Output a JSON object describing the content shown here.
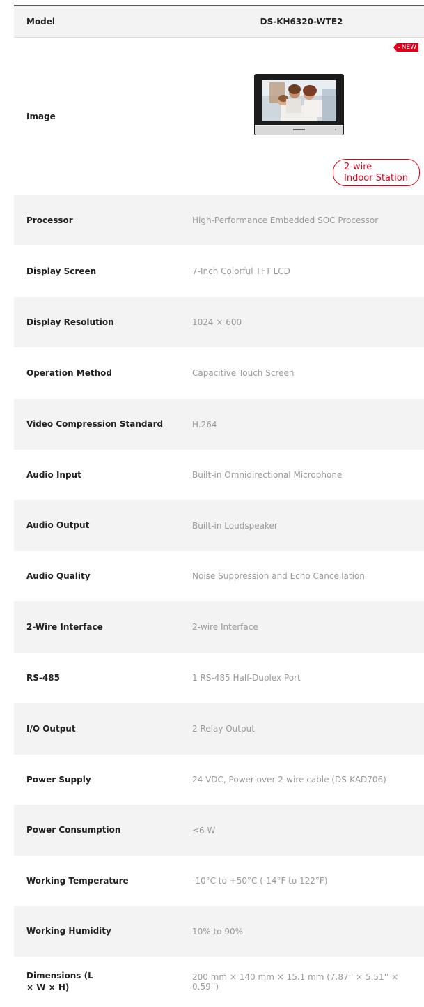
{
  "header": {
    "label": "Model",
    "value": "DS-KH6320-WTE2"
  },
  "image_row": {
    "label": "Image",
    "new_badge": "NEW",
    "tag_line1": "2-wire",
    "tag_line2": "Indoor Station"
  },
  "specs": [
    {
      "label": "Processor",
      "value": "High-Performance Embedded SOC Processor"
    },
    {
      "label": "Display Screen",
      "value": "7-Inch Colorful TFT LCD"
    },
    {
      "label": "Display Resolution",
      "value": "1024 × 600"
    },
    {
      "label": "Operation Method",
      "value": "Capacitive Touch Screen"
    },
    {
      "label": "Video Compression Standard",
      "value": "H.264"
    },
    {
      "label": "Audio Input",
      "value": "Built-in Omnidirectional Microphone"
    },
    {
      "label": "Audio Output",
      "value": "Built-in Loudspeaker"
    },
    {
      "label": "Audio Quality",
      "value": "Noise Suppression and Echo Cancellation"
    },
    {
      "label": "2-Wire Interface",
      "value": "2-wire Interface"
    },
    {
      "label": "RS-485",
      "value": "1 RS-485 Half-Duplex Port"
    },
    {
      "label": "I/O Output",
      "value": "2 Relay Output"
    },
    {
      "label": "Power Supply",
      "value": "24 VDC, Power over 2-wire cable (DS-KAD706)"
    },
    {
      "label": "Power Consumption",
      "value": "≤6 W"
    },
    {
      "label": "Working Temperature",
      "value": "-10°C to +50°C (-14°F to 122°F)"
    },
    {
      "label": "Working Humidity",
      "value": "10% to 90%"
    },
    {
      "label": "Dimensions (L × W × H)",
      "value": "200 mm × 140 mm × 15.1 mm (7.87'' × 5.51'' × 0.59'')"
    }
  ],
  "colors": {
    "accent": "#e3001b",
    "row_alt": "#f3f3f3",
    "label_text": "#222222",
    "value_text": "#9a9a9a"
  }
}
